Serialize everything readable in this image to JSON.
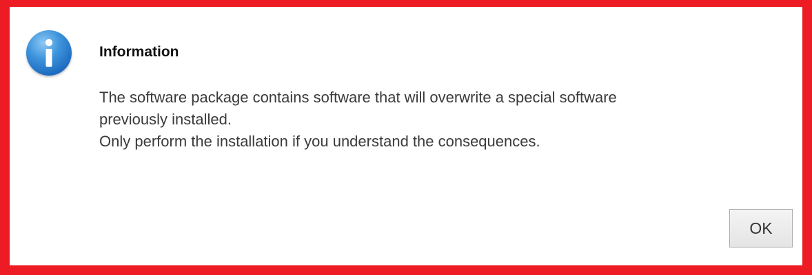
{
  "dialog": {
    "icon": "info-icon",
    "title": "Information",
    "message_lines": [
      "The software package contains software that will overwrite a special software",
      "previously installed.",
      "Only perform the installation if you understand the consequences."
    ],
    "ok_label": "OK"
  },
  "colors": {
    "highlight_border": "#ed1c24",
    "icon_blue": "#2a7fd0",
    "background": "#ffffff"
  }
}
